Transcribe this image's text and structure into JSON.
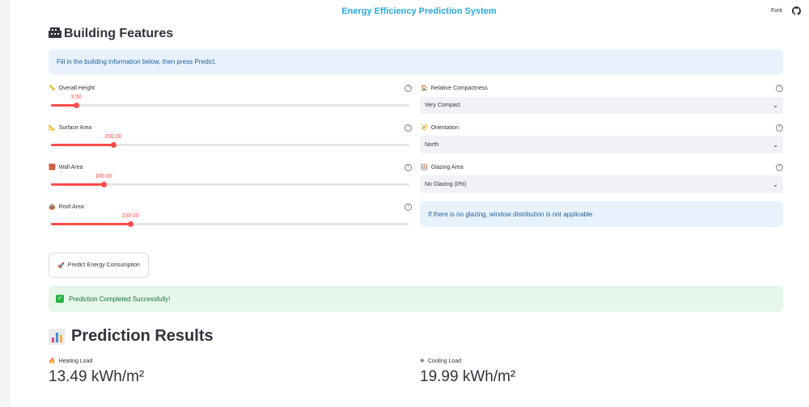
{
  "app": {
    "title": "Energy Efficiency Prediction System",
    "fork_label": "Fork",
    "github_icon": "github-icon"
  },
  "features": {
    "heading": "Building Features",
    "heading_icon": "building-icon",
    "info": "Fill in the building information below, then press Predict."
  },
  "sliders": [
    {
      "label": "Overall Height",
      "icon": "ruler-icon",
      "value": "3.50",
      "min": 3.5,
      "max": 7.0,
      "current": 3.5,
      "fraction": 0.07
    },
    {
      "label": "Surface Area",
      "icon": "triangle-ruler-icon",
      "value": "200.00",
      "fraction": 0.175
    },
    {
      "label": "Wall Area",
      "icon": "brick-icon",
      "value": "100.00",
      "fraction": 0.145
    },
    {
      "label": "Roof Area",
      "icon": "roof-icon",
      "value": "150.00",
      "fraction": 0.225
    }
  ],
  "selects": [
    {
      "label": "Relative Compactness",
      "icon": "house-icon",
      "value": "Very Compact"
    },
    {
      "label": "Orientation",
      "icon": "compass-icon",
      "value": "North"
    },
    {
      "label": "Glazing Area",
      "icon": "window-icon",
      "value": "No Glazing (0%)"
    }
  ],
  "glazing_note": "If there is no glazing, window distribution is not applicable.",
  "predict_button": {
    "label": "Predict Energy Consumption",
    "icon": "rocket-icon"
  },
  "success": {
    "message": "Prediction Completed Successfully!",
    "icon": "check-icon"
  },
  "results": {
    "heading": "Prediction Results",
    "heading_icon": "bar-chart-icon",
    "heating": {
      "label": "Heating Load",
      "icon": "fire-icon",
      "value": "13.49 kWh/m²"
    },
    "cooling": {
      "label": "Cooling Load",
      "icon": "snowflake-icon",
      "value": "19.99 kWh/m²"
    }
  },
  "colors": {
    "accent": "#ff4b4b",
    "title": "#29a9e0",
    "info_bg": "#e8f2fd",
    "success_bg": "#e7f6ea"
  }
}
